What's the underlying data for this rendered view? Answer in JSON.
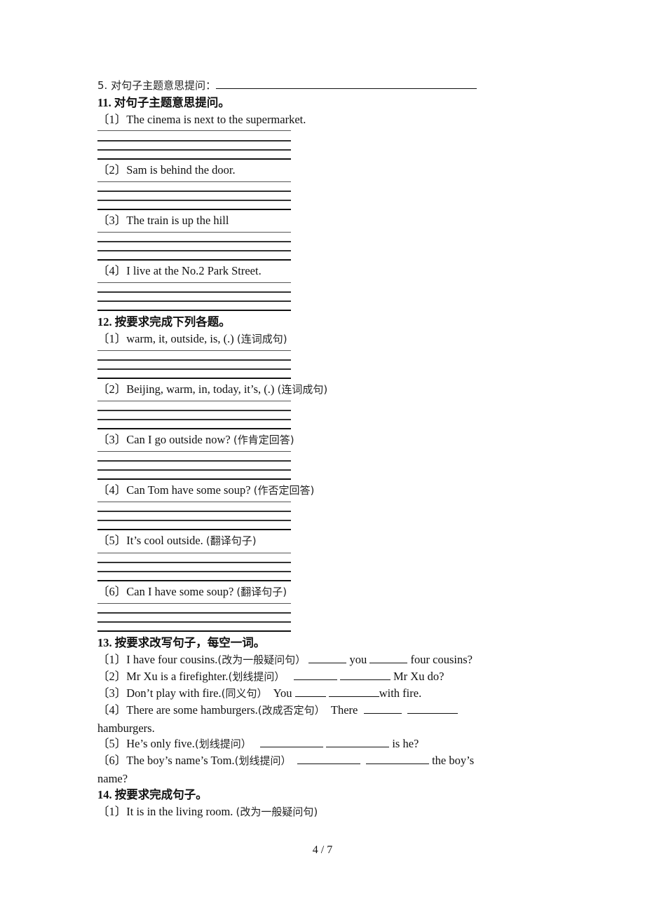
{
  "q5": {
    "label": "5. 对句子主题意思提问："
  },
  "q11": {
    "title": "11. 对句子主题意思提问。",
    "items": [
      {
        "num": "〔1〕",
        "text": "The cinema is next to the supermarket."
      },
      {
        "num": "〔2〕",
        "text": "Sam is behind the door."
      },
      {
        "num": "〔3〕",
        "text": "The train is up the hill"
      },
      {
        "num": "〔4〕",
        "text": "I live at the No.2 Park Street."
      }
    ]
  },
  "q12": {
    "title": "12. 按要求完成下列各题。",
    "items": [
      {
        "num": "〔1〕",
        "text": "warm, it, outside, is, (.) ",
        "hint": "(连词成句)"
      },
      {
        "num": "〔2〕",
        "text": "Beijing, warm, in, today, it’s, (.)   ",
        "hint": "(连词成句)"
      },
      {
        "num": "〔3〕",
        "text": "Can I go outside now? ",
        "hint": "(作肯定回答)"
      },
      {
        "num": "〔4〕",
        "text": "Can Tom have some soup?   ",
        "hint": "(作否定回答)"
      },
      {
        "num": "〔5〕",
        "text": "It’s cool outside.  ",
        "hint": "(翻译句子)"
      },
      {
        "num": "〔6〕",
        "text": "Can I have some soup?  ",
        "hint": "(翻译句子)"
      }
    ]
  },
  "q13": {
    "title": "13. 按要求改写句子，每空一词。",
    "items": [
      {
        "num": "〔1〕",
        "text": "I have four cousins.",
        "hint": "(改为一般疑问句）",
        "mid": "you",
        "end": "four cousins?"
      },
      {
        "num": "〔2〕",
        "text": "Mr Xu is a firefighter.",
        "hint": "(划线提问）",
        "end": "Mr Xu do?"
      },
      {
        "num": "〔3〕",
        "text": "Don’t play with fire.",
        "hint": "(同义句）",
        "start": "You",
        "end": "with fire."
      },
      {
        "num": "〔4〕",
        "text": "There are some hamburgers.",
        "hint": "(改成否定句）",
        "start": "There",
        "cont": "hamburgers."
      },
      {
        "num": "〔5〕",
        "text": "He’s only five.",
        "hint": "(划线提问）",
        "end": "is he?"
      },
      {
        "num": "〔6〕",
        "text": "The boy’s name’s Tom.",
        "hint": "(划线提问）",
        "end": "the boy’s",
        "cont": "name?"
      }
    ]
  },
  "q14": {
    "title": "14. 按要求完成句子。",
    "items": [
      {
        "num": "〔1〕",
        "text": "It is in the living room.  ",
        "hint": "(改为一般疑问句)"
      }
    ]
  },
  "footer": {
    "page": "4 / 7"
  }
}
